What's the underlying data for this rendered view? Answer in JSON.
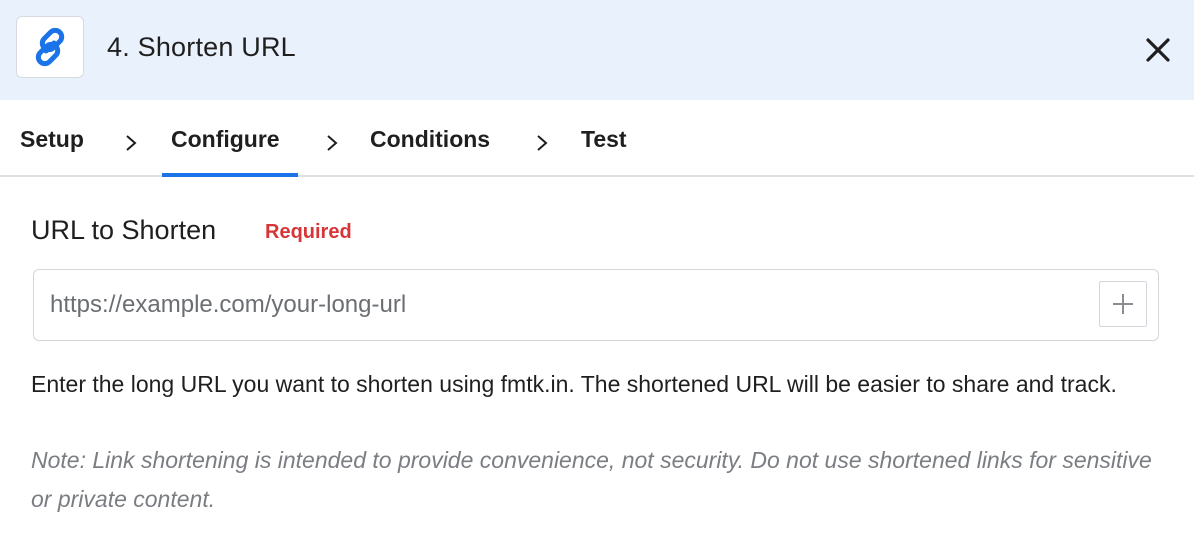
{
  "header": {
    "title": "4. Shorten URL",
    "icon": "link-icon",
    "close_icon": "close-icon",
    "accent_color": "#1a73e8",
    "background_color": "#e9f1fc"
  },
  "tabs": [
    {
      "label": "Setup",
      "active": false
    },
    {
      "label": "Configure",
      "active": true
    },
    {
      "label": "Conditions",
      "active": false
    },
    {
      "label": "Test",
      "active": false
    }
  ],
  "field": {
    "label": "URL to Shorten",
    "required_label": "Required",
    "required_color": "#d63638",
    "value": "",
    "placeholder": "https://example.com/your-long-url",
    "add_icon": "plus-icon"
  },
  "help_text": "Enter the long URL you want to shorten using fmtk.in. The shortened URL will be easier to share and track.",
  "note_text": "Note: Link shortening is intended to provide convenience, not security. Do not use shortened links for sensitive or private content."
}
